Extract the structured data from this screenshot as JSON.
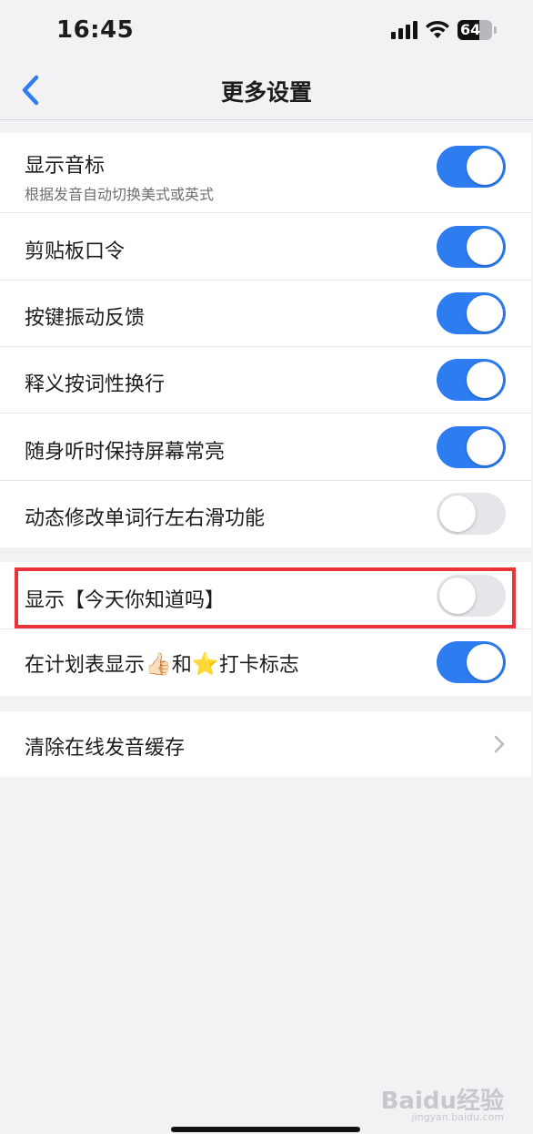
{
  "status_bar": {
    "time": "16:45",
    "battery": "64",
    "battery_level": 0.64,
    "icons": [
      "signal-icon",
      "wifi-icon",
      "battery-icon"
    ]
  },
  "nav": {
    "title": "更多设置",
    "back_icon": "chevron-left-icon"
  },
  "colors": {
    "accent": "#2d7df1",
    "highlight": "#e8343b",
    "background": "#f2f2f4"
  },
  "group1": [
    {
      "label": "显示音标",
      "sub": "根据发音自动切换美式或英式",
      "on": true
    },
    {
      "label": "剪贴板口令",
      "on": true
    },
    {
      "label": "按键振动反馈",
      "on": true
    },
    {
      "label": "释义按词性换行",
      "on": true
    },
    {
      "label": "随身听时保持屏幕常亮",
      "on": true
    },
    {
      "label": "动态修改单词行左右滑功能",
      "on": false
    }
  ],
  "group2": [
    {
      "label": "显示【今天你知道吗】",
      "on": false
    },
    {
      "label_parts": [
        "在计划表显示",
        "👍🏻",
        "和",
        "⭐",
        "打卡标志"
      ],
      "on": true
    }
  ],
  "group3": [
    {
      "label": "清除在线发音缓存",
      "icon": "chevron-right-icon"
    }
  ],
  "watermark": {
    "brand": "Baidu经验",
    "url": "jingyan.baidu.com"
  }
}
